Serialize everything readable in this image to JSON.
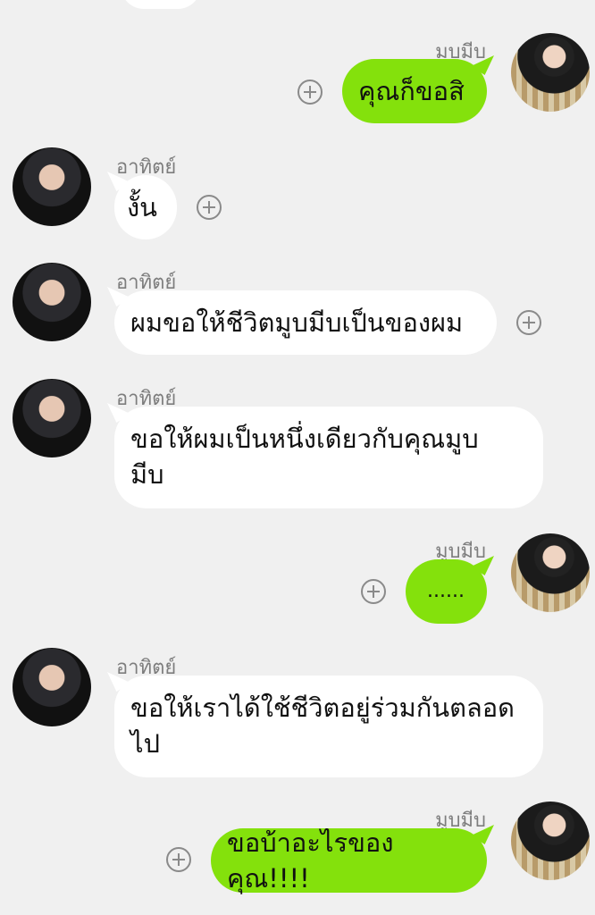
{
  "messages": [
    {
      "sender": "มูบมีบ",
      "side": "right",
      "text": "คุณก็ขอสิ"
    },
    {
      "sender": "อาทิตย์",
      "side": "left",
      "text": "งั้น"
    },
    {
      "sender": "อาทิตย์",
      "side": "left",
      "text": "ผมขอให้ชีวิตมูบมีบเป็นของผม"
    },
    {
      "sender": "อาทิตย์",
      "side": "left",
      "line1": "ขอให้ผมเป็นหนึ่งเดียวกับคุณมูบ",
      "line2": "มีบ"
    },
    {
      "sender": "มูบมีบ",
      "side": "right",
      "text": "......"
    },
    {
      "sender": "อาทิตย์",
      "side": "left",
      "line1": "ขอให้เราได้ใช้ชีวิตอยู่ร่วมกันตลอด",
      "line2": "ไป"
    },
    {
      "sender": "มูบมีบ",
      "side": "right",
      "text": "ขอบ้าอะไรของคุณ!!!!"
    }
  ],
  "colors": {
    "background": "#f0f0f0",
    "outgoing_bubble": "#84e10c",
    "incoming_bubble": "#ffffff",
    "name_text": "#7d7d7d"
  },
  "icons": {
    "add_reaction": "plus-circle-icon"
  }
}
